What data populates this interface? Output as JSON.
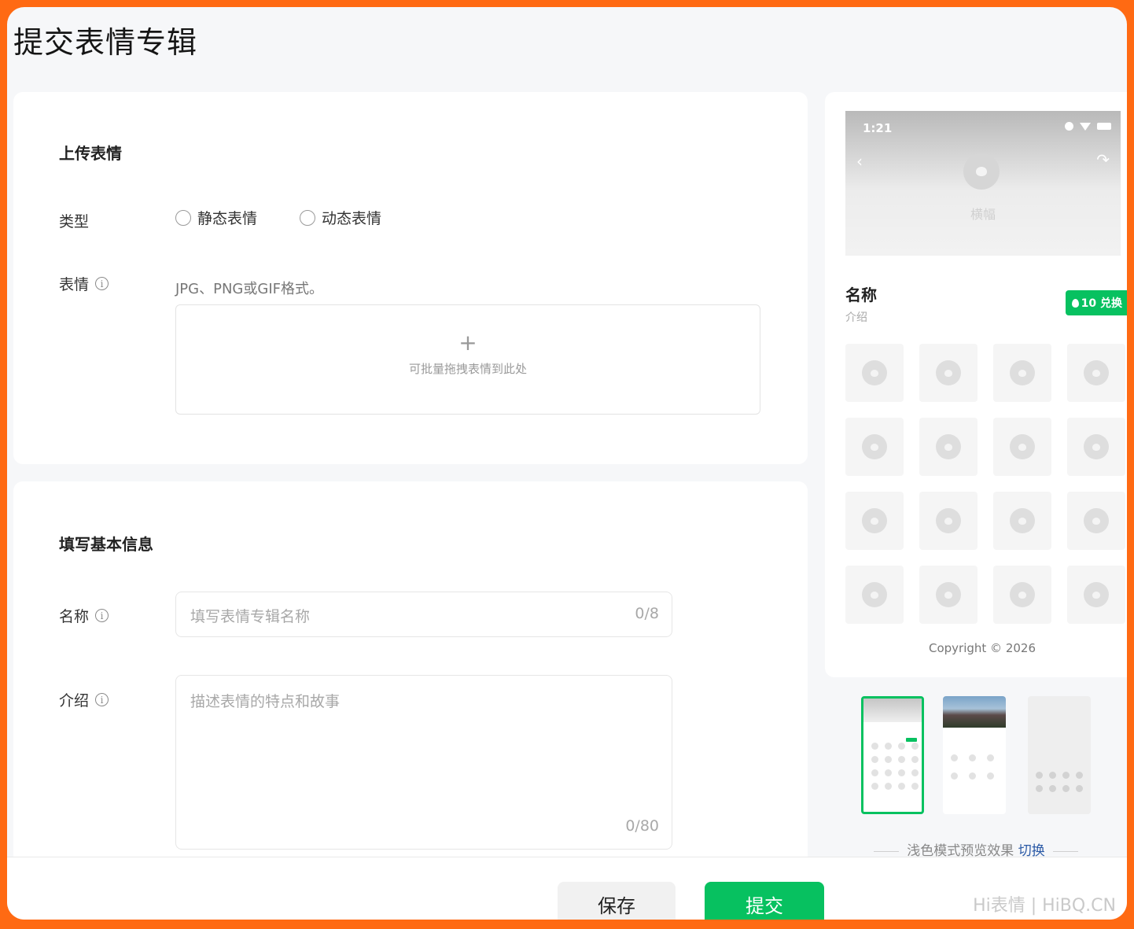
{
  "page": {
    "title": "提交表情专辑"
  },
  "upload": {
    "section_title": "上传表情",
    "type_label": "类型",
    "type_options": [
      "静态表情",
      "动态表情"
    ],
    "sticker_label": "表情",
    "format_hint": "JPG、PNG或GIF格式。",
    "drop_plus": "+",
    "drop_text": "可批量拖拽表情到此处"
  },
  "info": {
    "section_title": "填写基本信息",
    "name_label": "名称",
    "name_placeholder": "填写表情专辑名称",
    "name_count": "0/8",
    "intro_label": "介绍",
    "intro_placeholder": "描述表情的特点和故事",
    "intro_count": "0/80"
  },
  "preview": {
    "time": "1:21",
    "banner_label": "横幅",
    "name": "名称",
    "intro": "介绍",
    "redeem": "10 兑换",
    "copyright": "Copyright © 2026",
    "mode_text": "浅色模式预览效果",
    "mode_switch": "切换"
  },
  "footer": {
    "save": "保存",
    "submit": "提交",
    "watermark": "Hi表情 | HiBQ.CN"
  },
  "colors": {
    "accent": "#07c160",
    "border": "#ff6a13",
    "link": "#2b5aa6"
  },
  "icons": {
    "info": "info-icon",
    "plus": "plus-icon",
    "back": "back-icon",
    "share": "share-icon"
  }
}
